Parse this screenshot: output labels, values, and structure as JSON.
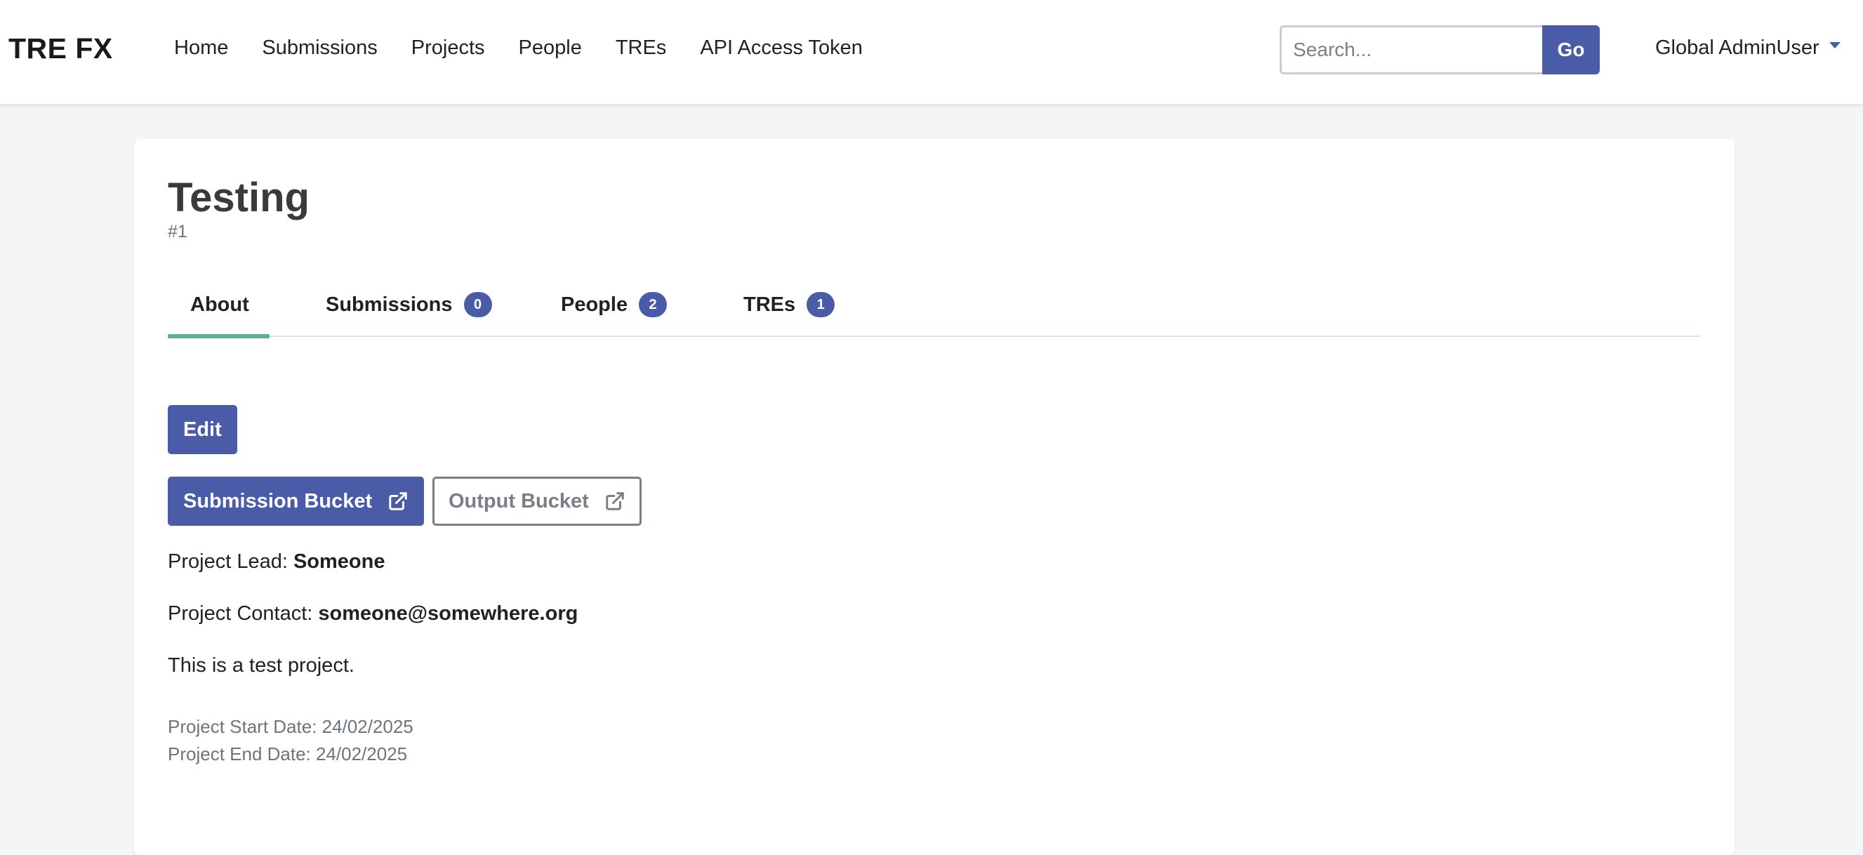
{
  "navbar": {
    "brand": "TRE FX",
    "links": [
      {
        "label": "Home"
      },
      {
        "label": "Submissions"
      },
      {
        "label": "Projects"
      },
      {
        "label": "People"
      },
      {
        "label": "TREs"
      },
      {
        "label": "API Access Token"
      }
    ],
    "search": {
      "placeholder": "Search...",
      "value": ""
    },
    "go_label": "Go",
    "user_label": "Global AdminUser"
  },
  "project": {
    "title": "Testing",
    "id": "#1",
    "tabs": [
      {
        "label": "About",
        "badge": null,
        "active": true
      },
      {
        "label": "Submissions",
        "badge": "0",
        "active": false
      },
      {
        "label": "People",
        "badge": "2",
        "active": false
      },
      {
        "label": "TREs",
        "badge": "1",
        "active": false
      }
    ],
    "edit_label": "Edit",
    "submission_bucket_label": "Submission Bucket",
    "output_bucket_label": "Output Bucket",
    "lead_label": "Project Lead:",
    "lead_value": "Someone",
    "contact_label": "Project Contact:",
    "contact_value": "someone@somewhere.org",
    "description": "This is a test project.",
    "start_date_line": "Project Start Date: 24/02/2025",
    "end_date_line": "Project End Date: 24/02/2025"
  },
  "colors": {
    "primary": "#4a5ca8",
    "active_tab_underline": "#5fae8f",
    "muted_text": "#6c757d",
    "page_background": "#f4f5f7"
  },
  "icons": {
    "external_link": "external-link-icon",
    "user_caret": "chevron-down-icon"
  }
}
